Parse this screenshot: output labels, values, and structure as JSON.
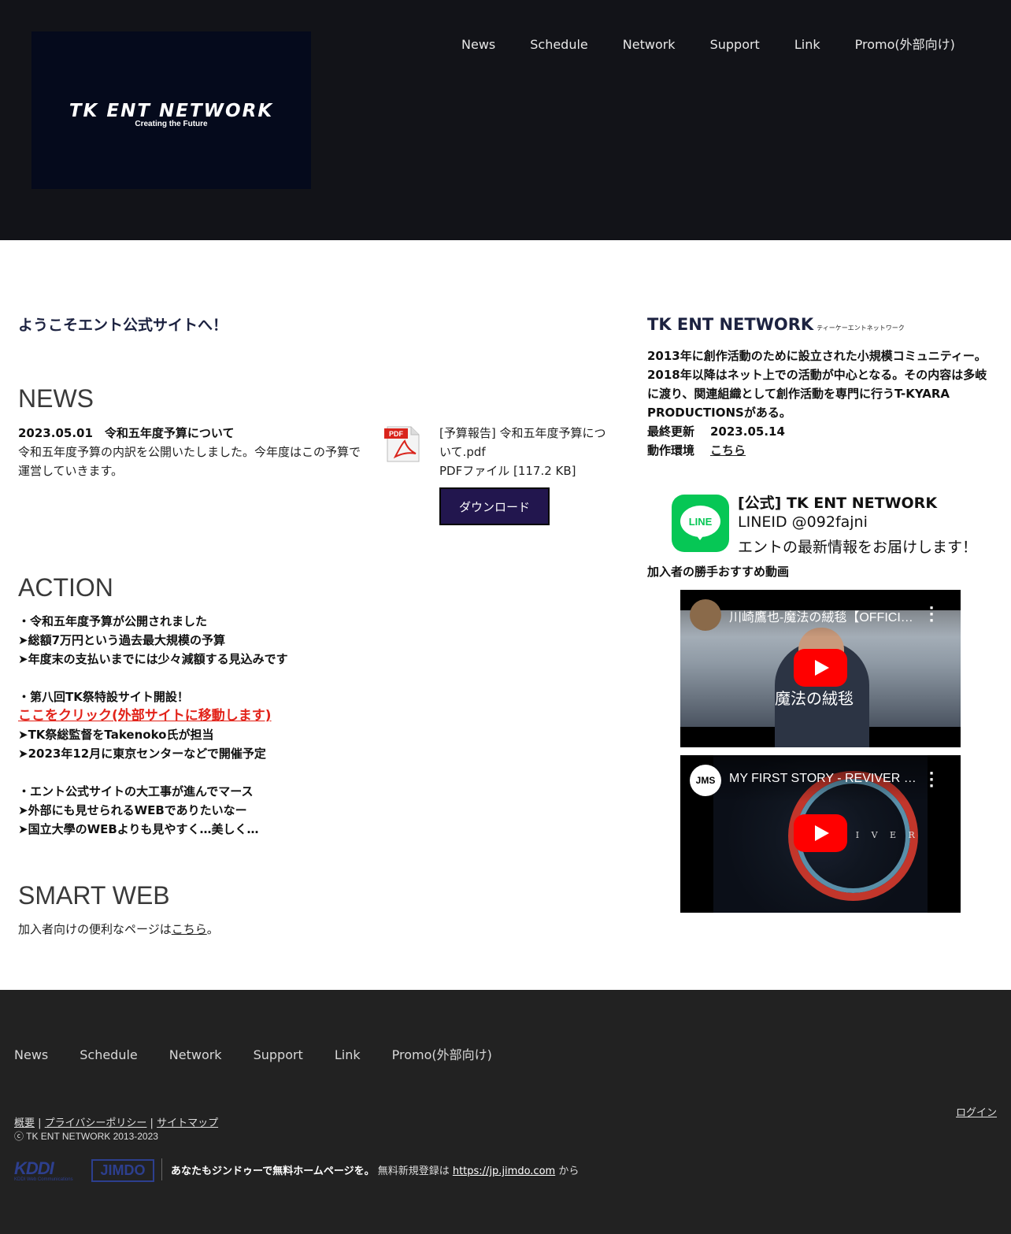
{
  "header": {
    "logo_text": "TK ENT NETWORK",
    "logo_tagline": "Creating the Future",
    "nav": [
      "News",
      "Schedule",
      "Network",
      "Support",
      "Link",
      "Promo(外部向け)"
    ]
  },
  "main": {
    "welcome": "ようこそエント公式サイトへ！",
    "news": {
      "title": "NEWS",
      "date_title": "2023.05.01　令和五年度予算について",
      "body": "令和五年度予算の内訳を公開いたしました。今年度はこの予算で運営していきます。",
      "file_name": "[予算報告] 令和五年度予算について.pdf",
      "file_meta": "PDFファイル [117.2 KB]",
      "pdf_icon_label": "PDF",
      "download_label": "ダウンロード"
    },
    "action": {
      "title": "ACTION",
      "lines": [
        "・令和五年度予算が公開されました",
        "➤総額7万円という過去最大規模の予算",
        "➤年度末の支払いまでには少々減額する見込みです",
        "",
        "・第八回TK祭特設サイト開設！",
        "ここをクリック(外部サイトに移動します)",
        "➤TK祭総監督をTakenoko氏が担当",
        "➤2023年12月に東京センターなどで開催予定",
        "",
        "・エント公式サイトの大工事が進んでマース",
        "➤外部にも見せられるWEBでありたいなー",
        "➤国立大學のWEBよりも見やすく…美しく…"
      ]
    },
    "smart_web": {
      "title": "SMART WEB",
      "text_before": "加入者向けの便利なページは",
      "link": "こちら",
      "text_after": "。"
    }
  },
  "sidebar": {
    "title": "TK ENT NETWORK",
    "title_ruby": "ティーケーエントネットワーク",
    "description": "2013年に創作活動のために設立された小規模コミュニティー。2018年以降はネット上での活動が中心となる。その内容は多岐に渡り、関連組織として創作活動を専門に行うT-KYARA PRODUCTIONSがある。",
    "last_updated_label": "最終更新",
    "last_updated_value": "2023.05.14",
    "env_label": "動作環境",
    "env_link": "こちら",
    "line": {
      "icon_text": "LINE",
      "name": "[公式] TK ENT NETWORK",
      "id": "LINEID @092fajni",
      "message": "エントの最新情報をお届けします！"
    },
    "recommended_label": "加入者の勝手おすすめ動画",
    "videos": [
      {
        "title": "川崎鷹也-魔法の絨毯【OFFICIAL MUSIC VIDEO】",
        "overlay": "魔法の絨毯"
      },
      {
        "title": "MY FIRST STORY - REVIVER -Official Video-",
        "overlay": "R E V I V E R",
        "avatar_text": "JMS"
      }
    ]
  },
  "footer": {
    "nav": [
      "News",
      "Schedule",
      "Network",
      "Support",
      "Link",
      "Promo(外部向け)"
    ],
    "legal_links": [
      "概要",
      "プライバシーポリシー",
      "サイトマップ"
    ],
    "copyright": "ⓒ TK ENT NETWORK 2013-2023",
    "login": "ログイン",
    "kddi_logo": "KDDI",
    "kddi_sub": "KDDI Web Communications",
    "jimdo_logo": "JIMDO",
    "promo_bold": "あなたもジンドゥーで無料ホームページを。",
    "promo_text": " 無料新規登録は ",
    "promo_link": "https://jp.jimdo.com",
    "promo_after": " から"
  },
  "colors": {
    "header_bg": "#121318",
    "footer_bg": "#222222",
    "button_bg": "#22164e",
    "link_red": "#e2231a",
    "line_green": "#06c755",
    "heading_navy": "#1c2240"
  }
}
